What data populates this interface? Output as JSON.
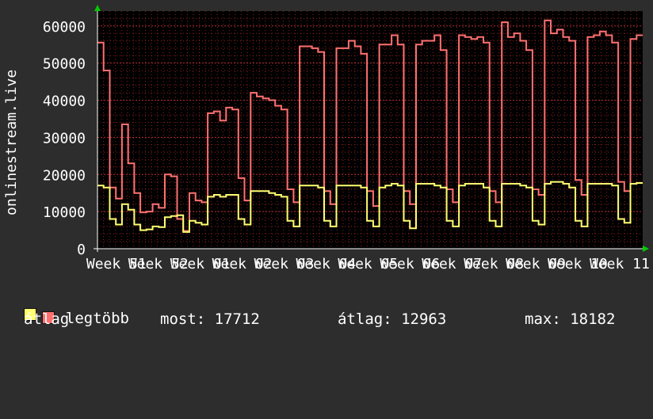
{
  "chart_data": {
    "type": "line",
    "ylabel": "onlinestream.live",
    "ylim": [
      0,
      64000
    ],
    "yticks": [
      0,
      10000,
      20000,
      30000,
      40000,
      50000,
      60000
    ],
    "xlabels": [
      "Week 51",
      "Week 52",
      "Week 01",
      "Week 02",
      "Week 03",
      "Week 04",
      "Week 05",
      "Week 06",
      "Week 07",
      "Week 08",
      "Week 09",
      "Week 10",
      "Week 11"
    ],
    "grid": true,
    "colors": {
      "legtobb": "#ff7070",
      "atlag": "#ffff70",
      "background": "#000000",
      "grid": "#8b2323"
    },
    "series": [
      {
        "name": "legtöbb",
        "color": "#ff7070",
        "values": [
          55500,
          48000,
          16500,
          13500,
          33500,
          23000,
          15000,
          9800,
          10000,
          12000,
          11000,
          20000,
          19500,
          8000,
          4800,
          15000,
          13000,
          12500,
          36500,
          37000,
          34500,
          38000,
          37500,
          19000,
          13000,
          42000,
          41000,
          40500,
          40000,
          38500,
          37500,
          16000,
          12500,
          54500,
          54500,
          54000,
          53000,
          15500,
          12000,
          54000,
          54000,
          56000,
          54500,
          52500,
          15500,
          11500,
          55000,
          55000,
          57500,
          55000,
          15500,
          12000,
          55000,
          56000,
          56000,
          57500,
          53500,
          16000,
          12500,
          57500,
          57000,
          56500,
          57000,
          55500,
          15500,
          12500,
          61000,
          57000,
          58000,
          56000,
          53500,
          16000,
          14500,
          61500,
          58000,
          59000,
          57000,
          56000,
          18500,
          14500,
          57000,
          57500,
          58500,
          57500,
          55500,
          18000,
          15500,
          56500,
          57500
        ]
      },
      {
        "name": "átlag",
        "color": "#ffff70",
        "values": [
          17000,
          16500,
          8000,
          6500,
          12000,
          10500,
          6500,
          5000,
          5200,
          6000,
          5800,
          8500,
          8800,
          9000,
          4500,
          7500,
          7000,
          6500,
          14000,
          14500,
          14000,
          14500,
          14500,
          8000,
          6500,
          15500,
          15500,
          15500,
          15000,
          14500,
          14000,
          7500,
          6000,
          17000,
          17000,
          17000,
          16500,
          7500,
          6000,
          17000,
          17000,
          17000,
          17000,
          16500,
          7500,
          6000,
          16500,
          17000,
          17500,
          17000,
          7500,
          5500,
          17500,
          17500,
          17500,
          17000,
          16500,
          7500,
          6000,
          17000,
          17500,
          17500,
          17500,
          16500,
          7500,
          6000,
          17500,
          17500,
          17500,
          17000,
          16500,
          7500,
          6500,
          17500,
          18000,
          18000,
          17500,
          16500,
          7500,
          6000,
          17500,
          17500,
          17500,
          17500,
          17000,
          8000,
          7000,
          17500,
          17700
        ]
      }
    ]
  },
  "legend": {
    "max_label": "legtöbb",
    "avg_label": "átlag",
    "stats": {
      "most": "most: 17712",
      "atlag": "átlag: 12963",
      "max": "max: 18182"
    }
  }
}
